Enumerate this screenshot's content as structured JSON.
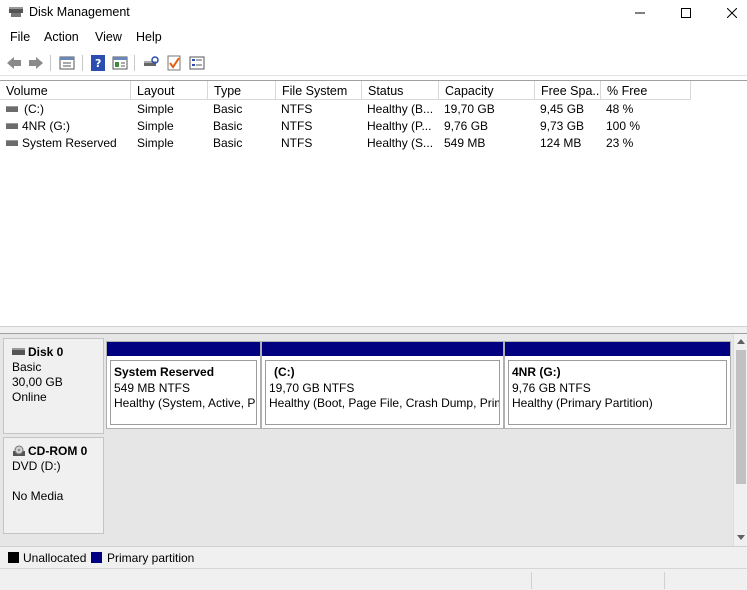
{
  "window": {
    "title": "Disk Management"
  },
  "menu": [
    "File",
    "Action",
    "View",
    "Help"
  ],
  "toolbar": {
    "icons": [
      "back-arrow-icon",
      "forward-arrow-icon",
      "properties-icon",
      "help-icon",
      "console-tree-icon",
      "rescan-icon",
      "check-icon",
      "list-icon"
    ]
  },
  "volumes": {
    "columns": [
      "Volume",
      "Layout",
      "Type",
      "File System",
      "Status",
      "Capacity",
      "Free Spa...",
      "% Free"
    ],
    "rows": [
      [
        "(C:)",
        "Simple",
        "Basic",
        "NTFS",
        "Healthy (B...",
        "19,70 GB",
        "9,45 GB",
        "48 %"
      ],
      [
        "4NR (G:)",
        "Simple",
        "Basic",
        "NTFS",
        "Healthy (P...",
        "9,76 GB",
        "9,73 GB",
        "100 %"
      ],
      [
        "System Reserved",
        "Simple",
        "Basic",
        "NTFS",
        "Healthy (S...",
        "549 MB",
        "124 MB",
        "23 %"
      ]
    ]
  },
  "disks": [
    {
      "name": "Disk 0",
      "type": "Basic",
      "size": "30,00 GB",
      "state": "Online",
      "partitions": [
        {
          "name": "System Reserved",
          "size": "549 MB NTFS",
          "status": "Healthy (System, Active, P"
        },
        {
          "name": "(C:)",
          "size": "19,70 GB NTFS",
          "status": "Healthy (Boot, Page File, Crash Dump, Prim"
        },
        {
          "name": "4NR  (G:)",
          "size": "9,76 GB NTFS",
          "status": "Healthy (Primary Partition)"
        }
      ]
    },
    {
      "name": "CD-ROM 0",
      "type": "DVD (D:)",
      "state": "No Media"
    }
  ],
  "legend": [
    {
      "label": "Unallocated",
      "color": "#000000"
    },
    {
      "label": "Primary partition",
      "color": "#000080"
    }
  ]
}
